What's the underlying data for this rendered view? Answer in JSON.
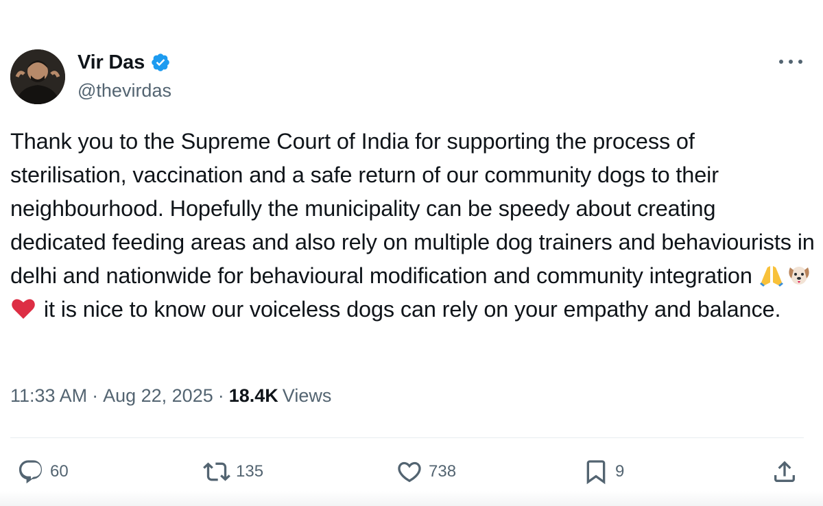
{
  "author": {
    "display_name": "Vir Das",
    "handle": "@thevirdas",
    "verified": true,
    "verified_color": "#1d9bf0"
  },
  "tweet": {
    "text_before_emoji": "Thank you to the Supreme Court of India for supporting the process of sterilisation, vaccination and a safe return of our community dogs to their neighbourhood. Hopefully the municipality can be speedy about creating dedicated feeding areas and also rely on multiple dog trainers and behaviourists in delhi and nationwide for behavioural modification and community integration ",
    "emojis": [
      "folded-hands-icon",
      "dog-face-icon",
      "red-heart-icon"
    ],
    "text_after_emoji": " it is nice to know our voiceless dogs can rely on your empathy and balance."
  },
  "meta": {
    "time": "11:33 AM",
    "separator": "·",
    "date": "Aug 22, 2025",
    "views_count": "18.4K",
    "views_label": "Views"
  },
  "actions": {
    "replies": "60",
    "reposts": "135",
    "likes": "738",
    "bookmarks": "9"
  },
  "colors": {
    "text_primary": "#0f1419",
    "text_secondary": "#536471",
    "divider": "#e6ecf0"
  }
}
